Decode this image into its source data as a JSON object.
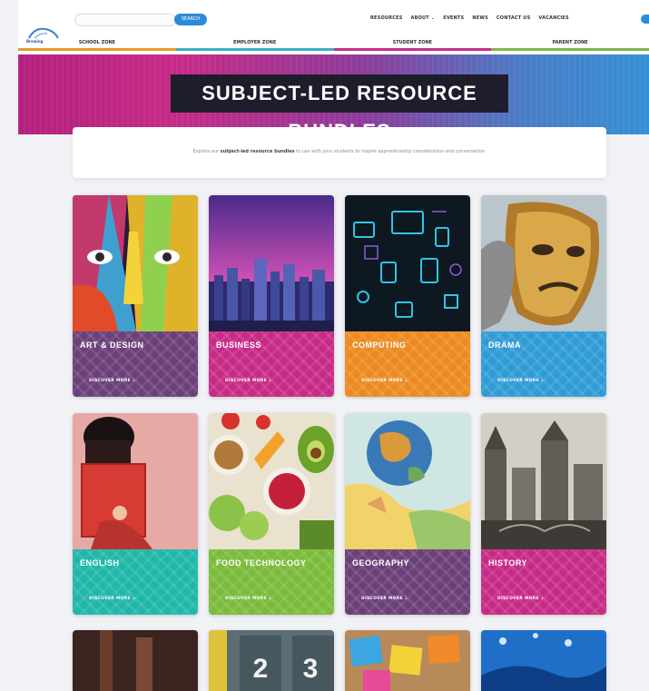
{
  "header": {
    "logo_text": "Brewing",
    "search_placeholder": "",
    "search_button": "SEARCH",
    "nav": [
      "RESOURCES",
      "ABOUT ⌄",
      "EVENTS",
      "NEWS",
      "CONTACT US",
      "VACANCIES"
    ],
    "zones": [
      "SCHOOL ZONE",
      "EMPLOYER ZONE",
      "STUDENT ZONE",
      "PARENT ZONE"
    ],
    "zone_colors": [
      "#e59a2a",
      "#3ab0c6",
      "#c5308a",
      "#7bb84a"
    ]
  },
  "banner": {
    "title": "SUBJECT-LED RESOURCE BUNDLES"
  },
  "intro": {
    "text_before": "Explore our ",
    "text_bold": "subject-led resource bundles",
    "text_after": " to use with your students to inspire apprenticeship consideration and conversation."
  },
  "cards": [
    {
      "label": "ART & DESIGN",
      "more": "DISCOVER MORE",
      "color": "#6b3f78"
    },
    {
      "label": "BUSINESS",
      "more": "DISCOVER MORE",
      "color": "#c72a86"
    },
    {
      "label": "COMPUTING",
      "more": "DISCOVER MORE",
      "color": "#ec8a1f"
    },
    {
      "label": "DRAMA",
      "more": "DISCOVER MORE",
      "color": "#2f9bd6"
    },
    {
      "label": "ENGLISH",
      "more": "DISCOVER MORE",
      "color": "#1fb7a8"
    },
    {
      "label": "FOOD TECHNOLOGY",
      "more": "DISCOVER MORE",
      "color": "#7bbb3b"
    },
    {
      "label": "GEOGRAPHY",
      "more": "DISCOVER MORE",
      "color": "#6b3f78"
    },
    {
      "label": "HISTORY",
      "more": "DISCOVER MORE",
      "color": "#c72a86"
    }
  ],
  "partial_cards": [
    "",
    "2",
    "3",
    ""
  ]
}
